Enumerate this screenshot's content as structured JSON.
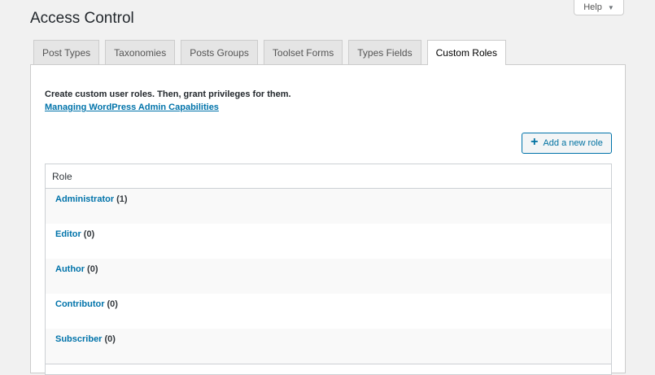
{
  "page": {
    "title": "Access Control"
  },
  "help": {
    "label": "Help",
    "caret": "▼"
  },
  "tabs": [
    {
      "label": "Post Types",
      "active": false
    },
    {
      "label": "Taxonomies",
      "active": false
    },
    {
      "label": "Posts Groups",
      "active": false
    },
    {
      "label": "Toolset Forms",
      "active": false
    },
    {
      "label": "Types Fields",
      "active": false
    },
    {
      "label": "Custom Roles",
      "active": true
    }
  ],
  "intro": {
    "text": "Create custom user roles. Then, grant privileges for them.",
    "link": "Managing WordPress Admin Capabilities"
  },
  "add_button": {
    "icon": "plus-icon",
    "label": "Add a new role"
  },
  "table": {
    "header": "Role",
    "rows": [
      {
        "name": "Administrator",
        "count": "(1)"
      },
      {
        "name": "Editor",
        "count": "(0)"
      },
      {
        "name": "Author",
        "count": "(0)"
      },
      {
        "name": "Contributor",
        "count": "(0)"
      },
      {
        "name": "Subscriber",
        "count": "(0)"
      }
    ]
  },
  "colors": {
    "link": "#0073aa",
    "background": "#f1f1f1",
    "border": "#ccd0d4"
  }
}
